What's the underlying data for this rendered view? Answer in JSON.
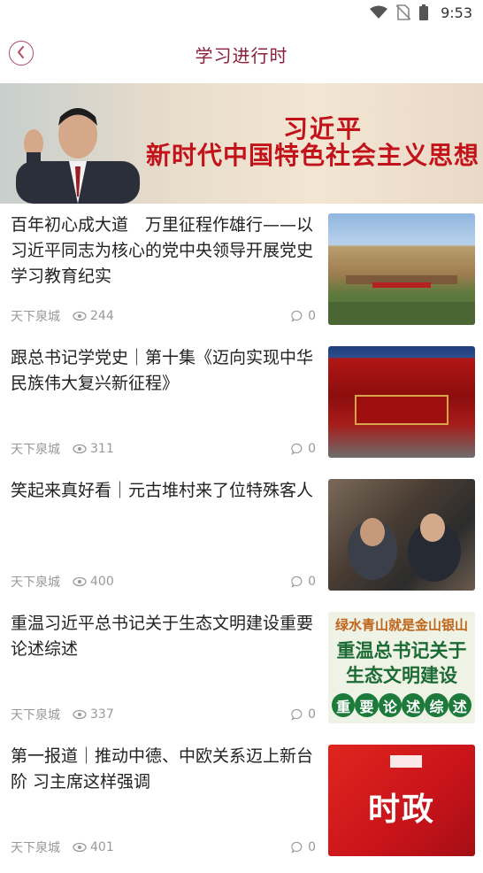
{
  "status_bar": {
    "time": "9:53",
    "icons": [
      "wifi-icon",
      "no-sim-icon",
      "battery-icon"
    ]
  },
  "app_bar": {
    "back_icon": "chevron-left-icon",
    "title": "学习进行时"
  },
  "banner": {
    "name": "习近平",
    "slogan": "新时代中国特色社会主义思想"
  },
  "articles": [
    {
      "title": "百年初心成大道　万里征程作雄行——以习近平同志为核心的党中央领导开展党史学习教育纪实",
      "source": "天下泉城",
      "views": "244",
      "comments": "0"
    },
    {
      "title": "跟总书记学党史｜第十集《迈向实现中华民族伟大复兴新征程》",
      "source": "天下泉城",
      "views": "311",
      "comments": "0"
    },
    {
      "title": "笑起来真好看｜元古堆村来了位特殊客人",
      "source": "天下泉城",
      "views": "400",
      "comments": "0"
    },
    {
      "title": "重温习近平总书记关于生态文明建设重要论述综述",
      "source": "天下泉城",
      "views": "337",
      "comments": "0",
      "thumb_text": {
        "line1": "绿水青山就是金山银山",
        "line2": "重温总书记关于生态文明建设",
        "circles": [
          "重",
          "要",
          "论",
          "述",
          "综",
          "述"
        ]
      }
    },
    {
      "title": "第一报道｜推动中德、中欧关系迈上新台阶 习主席这样强调",
      "source": "天下泉城",
      "views": "401",
      "comments": "0",
      "thumb_text": {
        "label": "时政"
      }
    }
  ],
  "colors": {
    "accent": "#8a1f3b",
    "banner_red": "#c2121a",
    "meta_gray": "#999999"
  }
}
